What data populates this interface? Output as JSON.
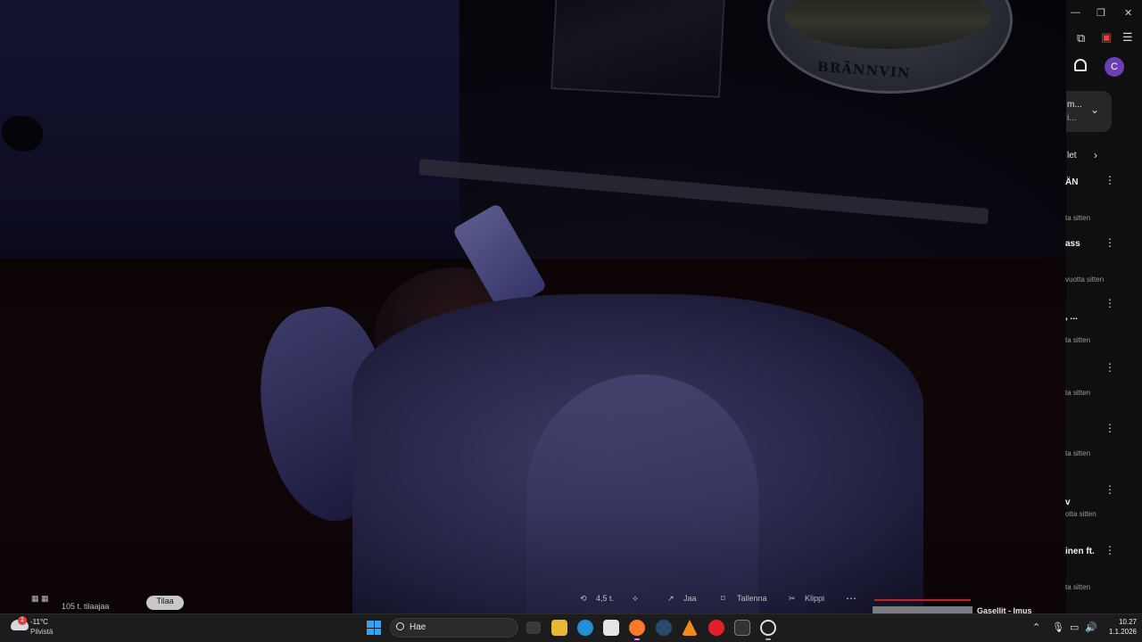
{
  "scene": {
    "poster_text": "BRÄNNVIN"
  },
  "youtube": {
    "chip_line1": "m...",
    "chip_line2": "i...",
    "filter_label": "let",
    "items": [
      {
        "title": "ÄN",
        "meta": "ta sitten"
      },
      {
        "title": "ass",
        "meta": "vuotta sitten"
      },
      {
        "title": ", ...",
        "meta": "ta sitten"
      },
      {
        "title": "",
        "meta": "ta sitten"
      },
      {
        "title": "",
        "meta": "ta sitten"
      },
      {
        "title": "v",
        "meta": "otta sitten"
      },
      {
        "title": "inen ft.",
        "meta": "ta sitten"
      }
    ]
  },
  "video_bar": {
    "subscribers": "105 t. tilaajaa",
    "subscribe_label": "Tilaa",
    "likes": "4,5 t.",
    "share": "Jaa",
    "save": "Tallenna",
    "clip": "Klippi",
    "next_title": "Gasellit - Imus"
  },
  "taskbar": {
    "temperature": "-11°C",
    "condition": "Pilvistä",
    "weather_badge": "1",
    "search_placeholder": "Hae",
    "time": "10.27",
    "date": "1.1.2026"
  },
  "colors": {
    "youtube_bg": "#0f0f0f",
    "taskbar_bg": "#1c1c1c",
    "avatar": "#6b3fb3",
    "progress_red": "#cc1b2a",
    "windows_blue": "#3aa0f0"
  },
  "icons": [
    "minimize-icon",
    "restore-icon",
    "close-icon",
    "extensions-icon",
    "menu-icon",
    "bell-icon",
    "chevron-down-icon",
    "chevron-right-icon",
    "kebab-icon",
    "windows-logo-icon",
    "search-icon",
    "file-explorer-icon",
    "edge-icon",
    "store-icon",
    "firefox-icon",
    "steam-icon",
    "vlc-icon",
    "opera-icon",
    "terminal-icon",
    "chatgpt-icon",
    "wifi-icon",
    "volume-icon",
    "mic-icon"
  ]
}
